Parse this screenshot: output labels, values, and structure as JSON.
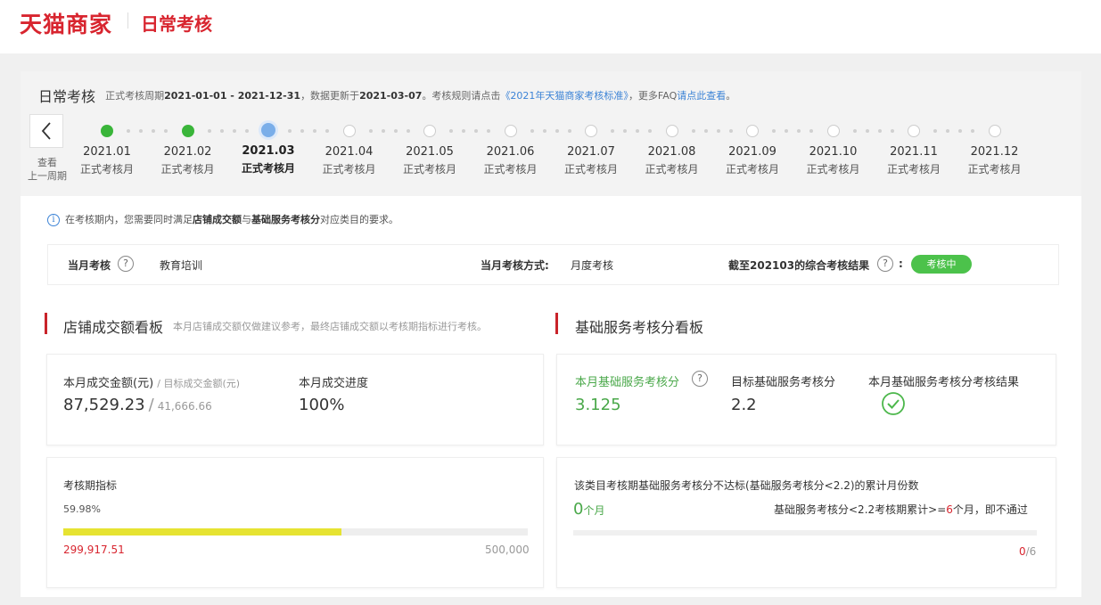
{
  "header": {
    "logo_text": "天猫商家",
    "module_title": "日常考核"
  },
  "period_bar": {
    "title": "日常考核",
    "text_prefix": "正式考核周期",
    "period": "2021-01-01 - 2021-12-31",
    "text_mid": "，数据更新于",
    "update_date": "2021-03-07",
    "text_rule": "。考核规则请点击",
    "rule_link": "《2021年天猫商家考核标准》",
    "text_faq": "，更多FAQ",
    "faq_link": "请点此查看",
    "text_end": "。"
  },
  "prev_period": {
    "icon": "chevron-left-icon",
    "label_line1": "查看",
    "label_line2": "上一周期"
  },
  "timeline": [
    {
      "date": "2021.01",
      "label": "正式考核月",
      "state": "done"
    },
    {
      "date": "2021.02",
      "label": "正式考核月",
      "state": "done"
    },
    {
      "date": "2021.03",
      "label": "正式考核月",
      "state": "current"
    },
    {
      "date": "2021.04",
      "label": "正式考核月",
      "state": "future"
    },
    {
      "date": "2021.05",
      "label": "正式考核月",
      "state": "future"
    },
    {
      "date": "2021.06",
      "label": "正式考核月",
      "state": "future"
    },
    {
      "date": "2021.07",
      "label": "正式考核月",
      "state": "future"
    },
    {
      "date": "2021.08",
      "label": "正式考核月",
      "state": "future"
    },
    {
      "date": "2021.09",
      "label": "正式考核月",
      "state": "future"
    },
    {
      "date": "2021.10",
      "label": "正式考核月",
      "state": "future"
    },
    {
      "date": "2021.11",
      "label": "正式考核月",
      "state": "future"
    },
    {
      "date": "2021.12",
      "label": "正式考核月",
      "state": "future"
    }
  ],
  "notice": {
    "icon": "info-icon",
    "prefix": "在考核期内，您需要同时满足",
    "bold1": "店铺成交额",
    "mid": "与",
    "bold2": "基础服务考核分",
    "suffix": "对应类目的要求。"
  },
  "summary": {
    "monthly_label": "当月考核",
    "help_glyph": "?",
    "category": "教育培训",
    "method_label": "当月考核方式:",
    "method_value": "月度考核",
    "result_label": "截至202103的综合考核结果",
    "result_colon": ":",
    "result_status": "考核中"
  },
  "left_section": {
    "title": "店铺成交额看板",
    "note": "本月店铺成交额仅做建议参考，最终店铺成交额以考核期指标进行考核。",
    "amount_label": "本月成交金额(元)",
    "target_label": "/ 目标成交金额(元)",
    "amount": "87,529.23",
    "slash": "/",
    "target": "41,666.66",
    "progress_label": "本月成交进度",
    "progress_value": "100%",
    "period_label": "考核期指标",
    "period_percent": "59.98%",
    "period_progress": 0.5998,
    "period_current": "299,917.51",
    "period_target": "500,000"
  },
  "right_section": {
    "title": "基础服务考核分看板",
    "score_label": "本月基础服务考核分",
    "score_value": "3.125",
    "target_label": "目标基础服务考核分",
    "target_value": "2.2",
    "result_label": "本月基础服务考核分考核结果",
    "result_icon": "check-circle-icon",
    "fail_label": "该类目考核期基础服务考核分不达标(基础服务考核分<2.2)的累计月份数",
    "fail_count": "0",
    "fail_unit": "个月",
    "rule_prefix": "基础服务考核分<2.2考核期累计>=",
    "rule_num": "6",
    "rule_suffix": "个月，即不通过",
    "count_current": "0",
    "count_total": "/6",
    "fail_progress": 0
  },
  "colors": {
    "brand": "#d8252f",
    "success": "#4cc24b",
    "link": "#3c83d6",
    "progress": "#e6e332"
  }
}
